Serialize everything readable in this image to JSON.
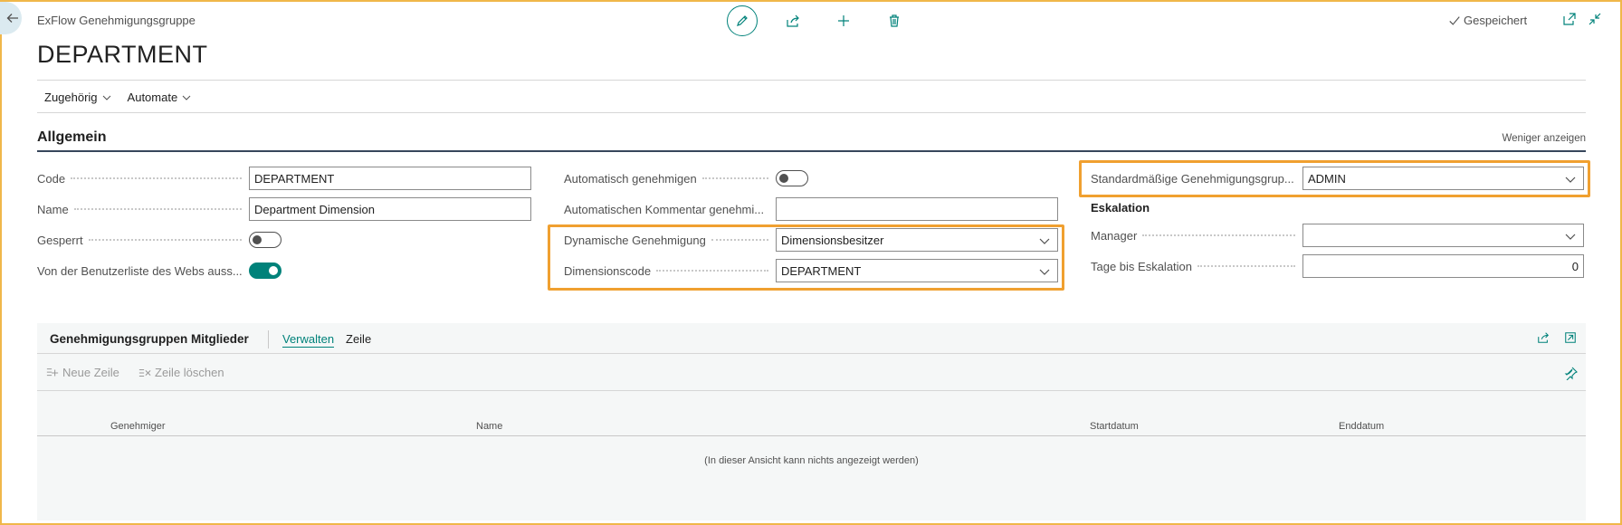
{
  "header": {
    "app_title": "ExFlow Genehmigungsgruppe",
    "page_title": "DEPARTMENT",
    "saved_label": "Gespeichert"
  },
  "actions": [
    {
      "label": "Zugehörig"
    },
    {
      "label": "Automate"
    }
  ],
  "section": {
    "title": "Allgemein",
    "toggle_link": "Weniger anzeigen"
  },
  "col1": {
    "code": {
      "label": "Code",
      "value": "DEPARTMENT"
    },
    "name": {
      "label": "Name",
      "value": "Department Dimension"
    },
    "blocked": {
      "label": "Gesperrt",
      "on": false
    },
    "exclude_web": {
      "label": "Von der Benutzerliste des Webs auss...",
      "on": true
    }
  },
  "col2": {
    "auto_approve": {
      "label": "Automatisch genehmigen",
      "on": false
    },
    "auto_comment": {
      "label": "Automatischen Kommentar genehmi...",
      "value": ""
    },
    "dynamic_approval": {
      "label": "Dynamische Genehmigung",
      "value": "Dimensionsbesitzer"
    },
    "dimension_code": {
      "label": "Dimensionscode",
      "value": "DEPARTMENT"
    }
  },
  "col3": {
    "default_group": {
      "label": "Standardmäßige Genehmigungsgrup...",
      "value": "ADMIN"
    },
    "escalation_title": "Eskalation",
    "manager": {
      "label": "Manager",
      "value": ""
    },
    "days_to_escalation": {
      "label": "Tage bis Eskalation",
      "value": "0"
    }
  },
  "subpage": {
    "title": "Genehmigungsgruppen Mitglieder",
    "tab_manage": "Verwalten",
    "tab_line": "Zeile",
    "new_line": "Neue Zeile",
    "delete_line": "Zeile löschen",
    "columns": [
      "Genehmiger",
      "Name",
      "Startdatum",
      "Enddatum"
    ],
    "empty_message": "(In dieser Ansicht kann nichts angezeigt werden)"
  },
  "colors": {
    "accent": "#00827a",
    "highlight": "#f0a030",
    "frame": "#f0b74a"
  }
}
